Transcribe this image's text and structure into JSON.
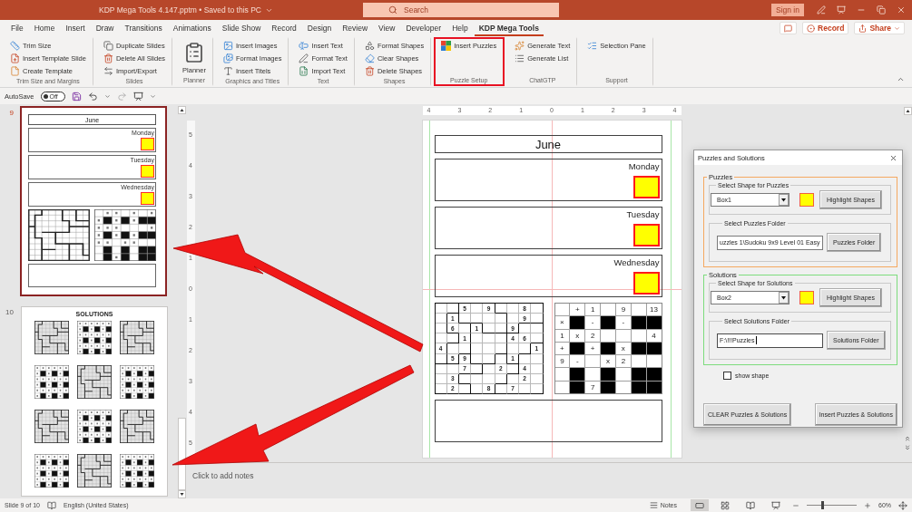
{
  "title_bar": {
    "title": "KDP Mega Tools 4.147.pptm • Saved to this PC",
    "search": {
      "placeholder": "Search"
    },
    "sign_in": "Sign in"
  },
  "tabs": [
    {
      "label": "File",
      "selected": false
    },
    {
      "label": "Home",
      "selected": false
    },
    {
      "label": "Insert",
      "selected": false
    },
    {
      "label": "Draw",
      "selected": false
    },
    {
      "label": "Transitions",
      "selected": false
    },
    {
      "label": "Animations",
      "selected": false
    },
    {
      "label": "Slide Show",
      "selected": false
    },
    {
      "label": "Record",
      "selected": false
    },
    {
      "label": "Design",
      "selected": false
    },
    {
      "label": "Review",
      "selected": false
    },
    {
      "label": "View",
      "selected": false
    },
    {
      "label": "Developer",
      "selected": false
    },
    {
      "label": "Help",
      "selected": false
    },
    {
      "label": "KDP Mega Tools",
      "selected": true
    }
  ],
  "tab_actions": {
    "record": "Record",
    "share": "Share"
  },
  "ribbon": [
    {
      "label": "Trim Size and Margins",
      "kind": "stack",
      "highlighted": false,
      "buttons": [
        "Trim Size",
        "Insert Template Slide",
        "Create Template"
      ]
    },
    {
      "label": "Slides",
      "kind": "stack",
      "highlighted": false,
      "buttons": [
        "Duplicate Slides",
        "Delete All Slides",
        "Import/Export"
      ]
    },
    {
      "label": "Planner",
      "kind": "large",
      "highlighted": false,
      "buttons": [
        "Planner"
      ]
    },
    {
      "label": "Graphics and Titles",
      "kind": "stack",
      "highlighted": false,
      "buttons": [
        "Insert Images",
        "Format Images",
        "Insert Titels"
      ]
    },
    {
      "label": "Text",
      "kind": "stack",
      "highlighted": false,
      "buttons": [
        "Insert Text",
        "Format Text",
        "Import Text"
      ]
    },
    {
      "label": "Shapes",
      "kind": "stack",
      "highlighted": false,
      "buttons": [
        "Format Shapes",
        "Clear Shapes",
        "Delete Shapes"
      ]
    },
    {
      "label": "Puzzle Setup",
      "kind": "stack",
      "highlighted": true,
      "buttons": [
        "Insert Puzzles"
      ]
    },
    {
      "label": "ChatGTP",
      "kind": "stack",
      "highlighted": false,
      "buttons": [
        "Generate Text",
        "Generate List"
      ]
    },
    {
      "label": "Support",
      "kind": "stack",
      "highlighted": false,
      "buttons": [
        "Selection Pane"
      ]
    }
  ],
  "quick_access": {
    "autosave": {
      "label": "AutoSave",
      "state_label": "Off",
      "on": false
    }
  },
  "slides_pane": [
    {
      "number": "9",
      "selected": true,
      "kind": "planner",
      "title": "June",
      "days": [
        "Monday",
        "Tuesday",
        "Wednesday"
      ]
    },
    {
      "number": "10",
      "selected": false,
      "kind": "solutions",
      "title": "SOLUTIONS"
    }
  ],
  "rulers": {
    "horizontal": [
      "4",
      "3",
      "2",
      "1",
      "0",
      "1",
      "2",
      "3",
      "4"
    ],
    "vertical": [
      "5",
      "4",
      "3",
      "2",
      "1",
      "0",
      "1",
      "2",
      "3",
      "4",
      "5"
    ]
  },
  "slide": {
    "title": "June",
    "days": [
      "Monday",
      "Tuesday",
      "Wednesday"
    ],
    "sudoku": [
      [
        {
          "kind": "empty"
        },
        {
          "kind": "empty"
        },
        {
          "kind": "given",
          "text": "5"
        },
        {
          "kind": "empty"
        },
        {
          "kind": "given",
          "text": "9"
        },
        {
          "kind": "empty"
        },
        {
          "kind": "empty"
        },
        {
          "kind": "given",
          "text": "8"
        },
        {
          "kind": "empty"
        }
      ],
      [
        {
          "kind": "empty"
        },
        {
          "kind": "given",
          "text": "1"
        },
        {
          "kind": "empty"
        },
        {
          "kind": "empty"
        },
        {
          "kind": "empty"
        },
        {
          "kind": "empty"
        },
        {
          "kind": "empty"
        },
        {
          "kind": "given",
          "text": "9"
        },
        {
          "kind": "empty"
        }
      ],
      [
        {
          "kind": "empty"
        },
        {
          "kind": "given",
          "text": "6"
        },
        {
          "kind": "empty"
        },
        {
          "kind": "given",
          "text": "1"
        },
        {
          "kind": "empty"
        },
        {
          "kind": "empty"
        },
        {
          "kind": "given",
          "text": "9"
        },
        {
          "kind": "empty"
        },
        {
          "kind": "empty"
        }
      ],
      [
        {
          "kind": "empty"
        },
        {
          "kind": "empty"
        },
        {
          "kind": "given",
          "text": "1"
        },
        {
          "kind": "empty"
        },
        {
          "kind": "empty"
        },
        {
          "kind": "empty"
        },
        {
          "kind": "given",
          "text": "4"
        },
        {
          "kind": "given",
          "text": "6"
        },
        {
          "kind": "empty"
        }
      ],
      [
        {
          "kind": "given",
          "text": "4"
        },
        {
          "kind": "empty"
        },
        {
          "kind": "empty"
        },
        {
          "kind": "empty"
        },
        {
          "kind": "empty"
        },
        {
          "kind": "empty"
        },
        {
          "kind": "empty"
        },
        {
          "kind": "empty"
        },
        {
          "kind": "given",
          "text": "1"
        }
      ],
      [
        {
          "kind": "empty"
        },
        {
          "kind": "given",
          "text": "5"
        },
        {
          "kind": "given",
          "text": "9"
        },
        {
          "kind": "empty"
        },
        {
          "kind": "empty"
        },
        {
          "kind": "empty"
        },
        {
          "kind": "given",
          "text": "1"
        },
        {
          "kind": "empty"
        },
        {
          "kind": "empty"
        }
      ],
      [
        {
          "kind": "empty"
        },
        {
          "kind": "empty"
        },
        {
          "kind": "given",
          "text": "7"
        },
        {
          "kind": "empty"
        },
        {
          "kind": "empty"
        },
        {
          "kind": "given",
          "text": "2"
        },
        {
          "kind": "empty"
        },
        {
          "kind": "given",
          "text": "4"
        },
        {
          "kind": "empty"
        }
      ],
      [
        {
          "kind": "empty"
        },
        {
          "kind": "given",
          "text": "3"
        },
        {
          "kind": "empty"
        },
        {
          "kind": "empty"
        },
        {
          "kind": "empty"
        },
        {
          "kind": "empty"
        },
        {
          "kind": "empty"
        },
        {
          "kind": "given",
          "text": "2"
        },
        {
          "kind": "empty"
        }
      ],
      [
        {
          "kind": "empty"
        },
        {
          "kind": "given",
          "text": "2"
        },
        {
          "kind": "empty"
        },
        {
          "kind": "empty"
        },
        {
          "kind": "given",
          "text": "8"
        },
        {
          "kind": "empty"
        },
        {
          "kind": "given",
          "text": "7"
        },
        {
          "kind": "empty"
        },
        {
          "kind": "empty"
        }
      ]
    ],
    "math_grid": [
      [
        {
          "kind": "empty"
        },
        {
          "kind": "text",
          "text": "+"
        },
        {
          "kind": "text",
          "text": "1"
        },
        {
          "kind": "empty"
        },
        {
          "kind": "text",
          "text": "9"
        },
        {
          "kind": "empty"
        },
        {
          "kind": "text",
          "text": "13"
        }
      ],
      [
        {
          "kind": "text",
          "text": "×"
        },
        {
          "kind": "black"
        },
        {
          "kind": "text",
          "text": "-"
        },
        {
          "kind": "black"
        },
        {
          "kind": "text",
          "text": "-"
        },
        {
          "kind": "black"
        },
        {
          "kind": "black"
        }
      ],
      [
        {
          "kind": "text",
          "text": "1"
        },
        {
          "kind": "text",
          "text": "x"
        },
        {
          "kind": "text",
          "text": "2"
        },
        {
          "kind": "empty"
        },
        {
          "kind": "empty"
        },
        {
          "kind": "empty"
        },
        {
          "kind": "text",
          "text": "4"
        }
      ],
      [
        {
          "kind": "text",
          "text": "+"
        },
        {
          "kind": "black"
        },
        {
          "kind": "text",
          "text": "+"
        },
        {
          "kind": "black"
        },
        {
          "kind": "text",
          "text": "x"
        },
        {
          "kind": "black"
        },
        {
          "kind": "black"
        }
      ],
      [
        {
          "kind": "text",
          "text": "9"
        },
        {
          "kind": "text",
          "text": "-"
        },
        {
          "kind": "empty"
        },
        {
          "kind": "text",
          "text": "x"
        },
        {
          "kind": "text",
          "text": "2"
        },
        {
          "kind": "empty"
        },
        {
          "kind": "empty"
        }
      ],
      [
        {
          "kind": "empty"
        },
        {
          "kind": "black"
        },
        {
          "kind": "empty"
        },
        {
          "kind": "black"
        },
        {
          "kind": "empty"
        },
        {
          "kind": "black"
        },
        {
          "kind": "black"
        }
      ],
      [
        {
          "kind": "empty"
        },
        {
          "kind": "black"
        },
        {
          "kind": "text",
          "text": "7"
        },
        {
          "kind": "black"
        },
        {
          "kind": "empty"
        },
        {
          "kind": "black"
        },
        {
          "kind": "black"
        }
      ]
    ]
  },
  "notes": {
    "placeholder": "Click to add notes"
  },
  "dialog": {
    "title": "Puzzles and Solutions",
    "sections": [
      {
        "legend": "Puzzles",
        "color": "#f5a860",
        "shape": {
          "legend": "Select Shape for Puzzles",
          "value": "Box1",
          "button": "Highlight Shapes"
        },
        "folder": {
          "legend": "Select Puzzles Folder",
          "value": "uzzles 1\\Sudoku 9x9 Level 01 Easy",
          "focused": false,
          "button": "Puzzles Folder"
        }
      },
      {
        "legend": "Solutions",
        "color": "#7ddc7d",
        "shape": {
          "legend": "Select Shape for Solutions",
          "value": "Box2",
          "button": "Highlight Shapes"
        },
        "folder": {
          "legend": "Select Solutions Folder",
          "value": "F:\\!!!Puzzles",
          "focused": true,
          "button": "Solutions Folder"
        }
      }
    ],
    "show_shape": {
      "label": "show shape",
      "checked": false
    },
    "buttons": [
      "CLEAR Puzzles & Solutions",
      "Insert Puzzles & Solutions"
    ]
  },
  "status_bar": {
    "slide": "Slide 9 of 10",
    "language": "English (United States)",
    "notes": "Notes",
    "views": [
      {
        "kind": "normal",
        "selected": true
      },
      {
        "kind": "sorter",
        "selected": false
      },
      {
        "kind": "reading",
        "selected": false
      },
      {
        "kind": "slideshow",
        "selected": false
      }
    ],
    "zoom": {
      "level": 0.32,
      "reading": "60%"
    }
  }
}
